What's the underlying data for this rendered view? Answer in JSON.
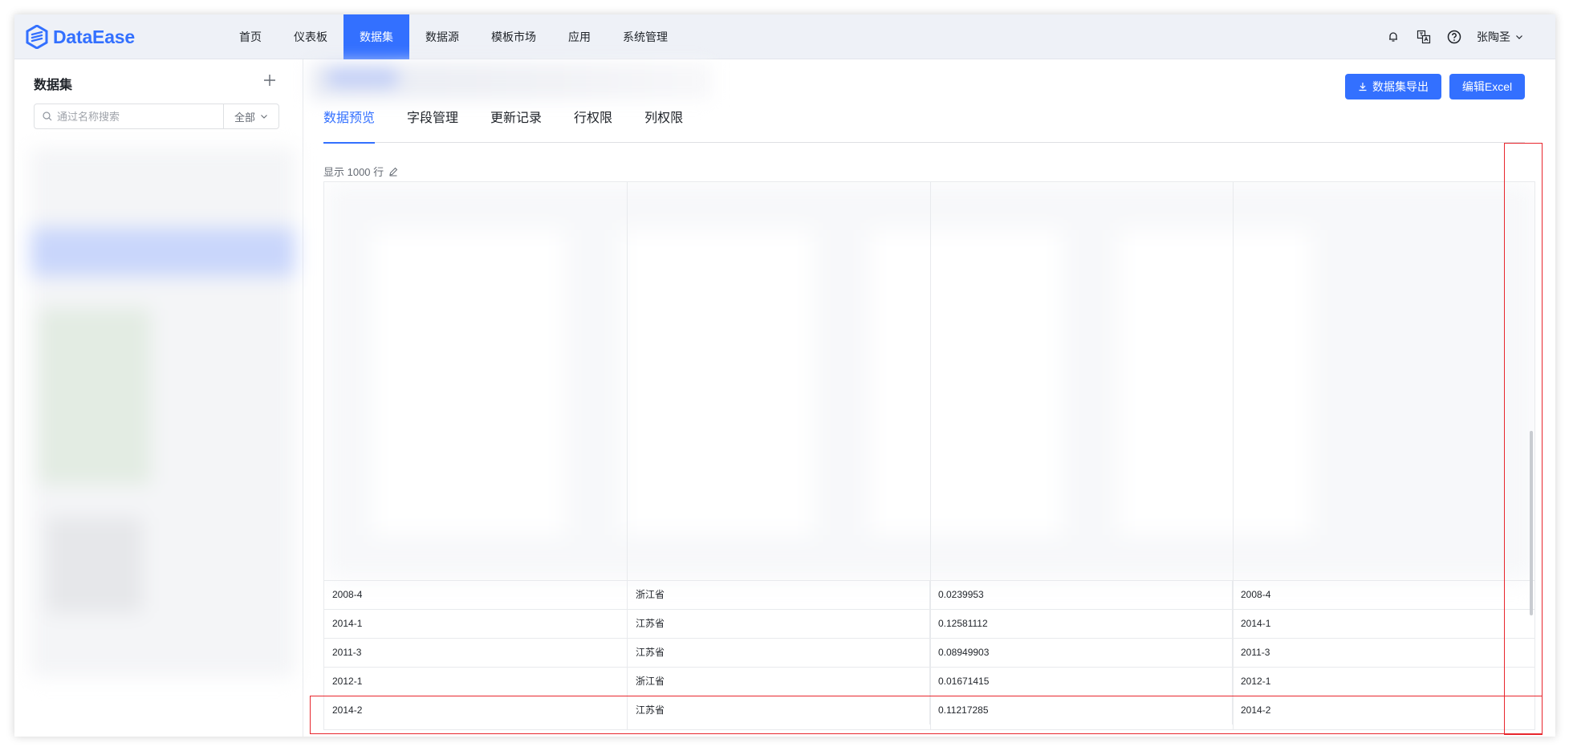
{
  "header": {
    "logo_text": "DataEase",
    "nav": [
      {
        "label": "首页",
        "active": false
      },
      {
        "label": "仪表板",
        "active": false
      },
      {
        "label": "数据集",
        "active": true
      },
      {
        "label": "数据源",
        "active": false
      },
      {
        "label": "模板市场",
        "active": false
      },
      {
        "label": "应用",
        "active": false
      },
      {
        "label": "系统管理",
        "active": false
      }
    ],
    "icons": [
      "bell-icon",
      "translate-icon",
      "help-icon"
    ],
    "username": "张陶圣"
  },
  "sidebar": {
    "title": "数据集",
    "search_placeholder": "通过名称搜索",
    "filter_label": "全部"
  },
  "main": {
    "export_button": "数据集导出",
    "excel_button": "编辑Excel",
    "tabs": [
      {
        "label": "数据预览",
        "active": true
      },
      {
        "label": "字段管理",
        "active": false
      },
      {
        "label": "更新记录",
        "active": false
      },
      {
        "label": "行权限",
        "active": false
      },
      {
        "label": "列权限",
        "active": false
      }
    ],
    "row_count_label": "显示 1000 行"
  },
  "table": {
    "rows": [
      [
        "2008-4",
        "浙江省",
        "0.0239953",
        "2008-4"
      ],
      [
        "2014-1",
        "江苏省",
        "0.12581112",
        "2014-1"
      ],
      [
        "2011-3",
        "江苏省",
        "0.08949903",
        "2011-3"
      ],
      [
        "2012-1",
        "浙江省",
        "0.01671415",
        "2012-1"
      ],
      [
        "2014-2",
        "江苏省",
        "0.11217285",
        "2014-2"
      ]
    ]
  },
  "colors": {
    "accent": "#3370ff",
    "annotation": "#e8262d"
  }
}
